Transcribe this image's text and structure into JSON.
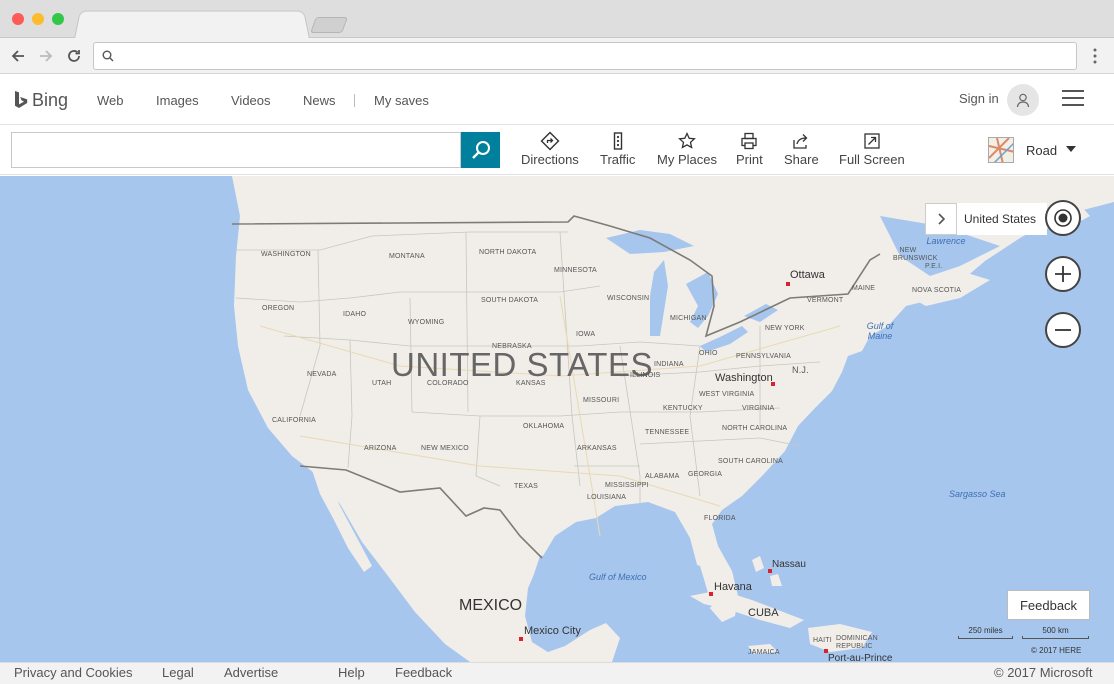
{
  "browser": {
    "omnibox_value": "",
    "icons": [
      "back-arrow-icon",
      "forward-arrow-icon",
      "reload-icon",
      "search-icon",
      "menu-dots-icon"
    ]
  },
  "header": {
    "logo_text": "Bing",
    "nav": [
      "Web",
      "Images",
      "Videos",
      "News",
      "My saves"
    ],
    "sign_in": "Sign in"
  },
  "toolbar": {
    "search_value": "",
    "tools": [
      "Directions",
      "Traffic",
      "My Places",
      "Print",
      "Share",
      "Full Screen"
    ],
    "map_style": "Road"
  },
  "map": {
    "location": "United States",
    "country_labels": [
      "UNITED STATES",
      "MEXICO"
    ],
    "states": [
      "WASHINGTON",
      "OREGON",
      "CALIFORNIA",
      "NEVADA",
      "IDAHO",
      "MONTANA",
      "WYOMING",
      "UTAH",
      "ARIZONA",
      "COLORADO",
      "NEW MEXICO",
      "NORTH DAKOTA",
      "SOUTH DAKOTA",
      "NEBRASKA",
      "KANSAS",
      "OKLAHOMA",
      "TEXAS",
      "MINNESOTA",
      "IOWA",
      "MISSOURI",
      "ARKANSAS",
      "LOUISIANA",
      "WISCONSIN",
      "ILLINOIS",
      "MISSISSIPPI",
      "ALABAMA",
      "TENNESSEE",
      "KENTUCKY",
      "INDIANA",
      "MICHIGAN",
      "OHIO",
      "GEORGIA",
      "FLORIDA",
      "SOUTH CAROLINA",
      "NORTH CAROLINA",
      "VIRGINIA",
      "WEST VIRGINIA",
      "PENNSYLVANIA",
      "NEW YORK",
      "VERMONT",
      "MAINE",
      "NEW BRUNSWICK",
      "P.E.I.",
      "NOVA SCOTIA",
      "N.J.",
      "CUBA",
      "HAITI",
      "DOMINICAN REPUBLIC",
      "JAMAICA"
    ],
    "cities": [
      "Ottawa",
      "Washington",
      "Nassau",
      "Havana",
      "Mexico City",
      "Port-au-Prince"
    ],
    "water": [
      "Gulf of Mexico",
      "Sargasso Sea",
      "Gulf of Maine",
      "Gulf of St. Lawrence"
    ],
    "feedback": "Feedback",
    "scale": [
      "250 miles",
      "500 km"
    ],
    "attribution": "© 2017 HERE"
  },
  "footer": {
    "links": [
      "Privacy and Cookies",
      "Legal",
      "Advertise",
      "Help",
      "Feedback"
    ],
    "copyright": "© 2017 Microsoft"
  },
  "colors": {
    "water": "#a7c6ee",
    "land": "#f1eee9",
    "accent": "#00809d",
    "city_marker": "#d9232a"
  }
}
